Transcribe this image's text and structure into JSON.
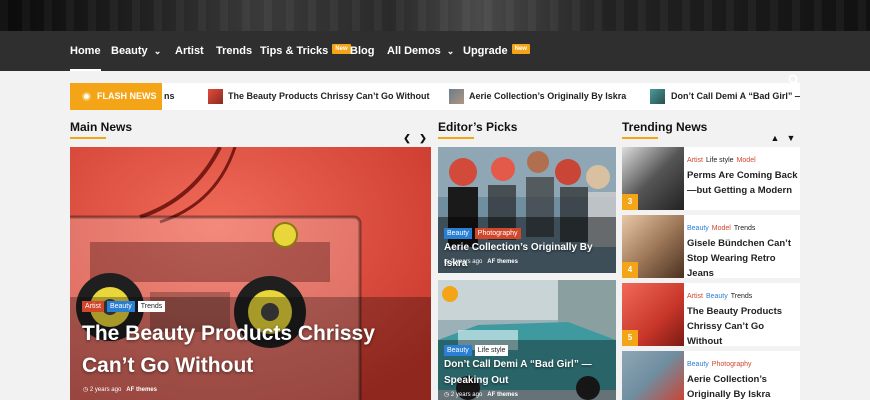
{
  "nav": {
    "items": [
      {
        "label": "Home",
        "active": true
      },
      {
        "label": "Beauty",
        "dropdown": true
      },
      {
        "label": "Artist"
      },
      {
        "label": "Trends"
      },
      {
        "label": "Tips & Tricks",
        "badge": "New"
      },
      {
        "label": "Blog"
      },
      {
        "label": "All Demos",
        "dropdown": true
      },
      {
        "label": "Upgrade",
        "badge": "New"
      }
    ],
    "search_icon": "search-icon"
  },
  "flash": {
    "label": "FLASH NEWS",
    "items": [
      "ns",
      "The Beauty Products Chrissy Can’t Go Without",
      "Aerie Collection’s Originally By Iskra",
      "Don’t Call Demi A “Bad Girl” —"
    ]
  },
  "sections": {
    "main": "Main News",
    "editors": "Editor’s Picks",
    "trending": "Trending News"
  },
  "main_feature": {
    "tags": [
      "Artist",
      "Beauty",
      "Trends"
    ],
    "title": "The Beauty Products Chrissy Can’t Go Without",
    "time": "2 years ago",
    "author": "AF themes"
  },
  "editors_picks": [
    {
      "tags": [
        "Beauty",
        "Photography"
      ],
      "title": "Aerie Collection’s Originally By Iskra",
      "time": "2 years ago",
      "author": "AF themes"
    },
    {
      "tags": [
        "Beauty",
        "Life style"
      ],
      "title": "Don’t Call Demi A “Bad Girl” — Speaking Out",
      "time": "2 years ago",
      "author": "AF themes"
    }
  ],
  "trending": [
    {
      "num": "3",
      "tags": [
        "Artist",
        "Life style",
        "Model"
      ],
      "title": "Perms Are Coming Back—but Getting a Modern"
    },
    {
      "num": "4",
      "tags": [
        "Beauty",
        "Model",
        "Trends"
      ],
      "title": "Gisele Bündchen Can’t Stop Wearing Retro Jeans"
    },
    {
      "num": "5",
      "tags": [
        "Artist",
        "Beauty",
        "Trends"
      ],
      "title": "The Beauty Products Chrissy Can’t Go Without"
    },
    {
      "num": "",
      "tags": [
        "Beauty",
        "Photography"
      ],
      "title": "Aerie Collection’s Originally By Iskra"
    }
  ],
  "colors": {
    "accent": "#f4a517",
    "nav_bg": "#2f2f2f",
    "tag_red": "#d1472b",
    "tag_blue": "#2a7fd4"
  }
}
